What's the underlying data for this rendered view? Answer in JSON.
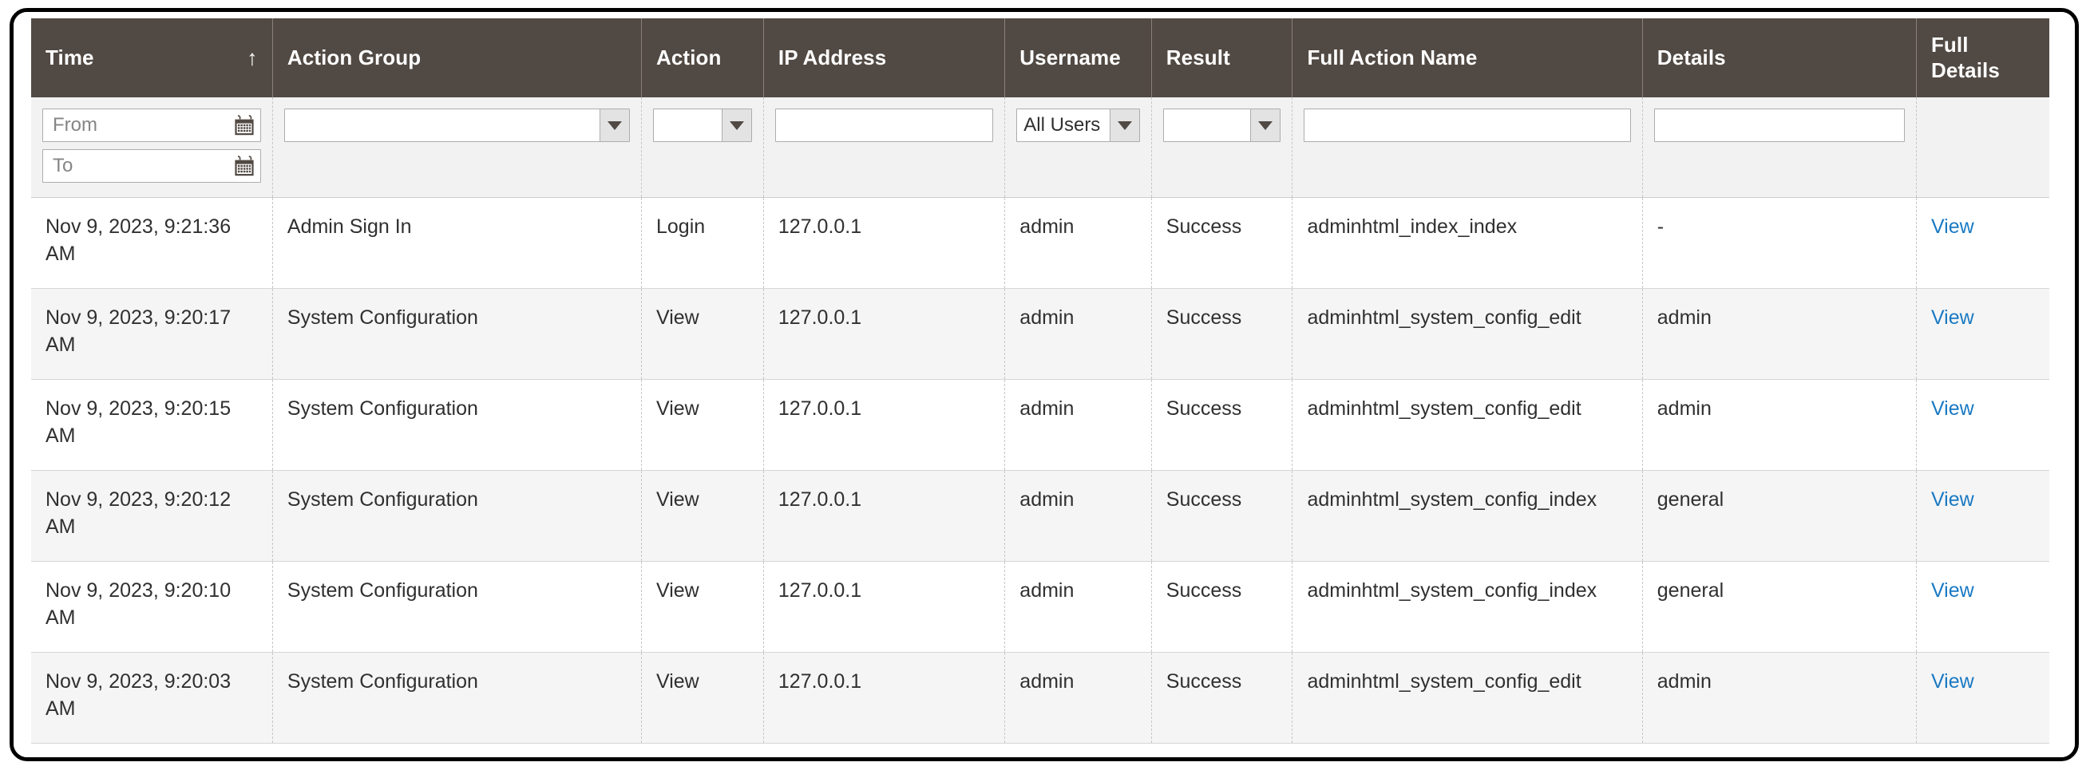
{
  "colors": {
    "header_bg": "#514943",
    "link": "#1979c3",
    "row_alt_bg": "#f5f5f5",
    "filter_bg": "#f2f2f2",
    "frame_border": "#000000"
  },
  "grid": {
    "columns": [
      {
        "key": "time",
        "label": "Time",
        "sorted": true,
        "sort_icon": "↑"
      },
      {
        "key": "action_group",
        "label": "Action Group",
        "sorted": false
      },
      {
        "key": "action",
        "label": "Action",
        "sorted": false
      },
      {
        "key": "ip_address",
        "label": "IP Address",
        "sorted": false
      },
      {
        "key": "username",
        "label": "Username",
        "sorted": false
      },
      {
        "key": "result",
        "label": "Result",
        "sorted": false
      },
      {
        "key": "full_action",
        "label": "Full Action Name",
        "sorted": false
      },
      {
        "key": "details",
        "label": "Details",
        "sorted": false
      },
      {
        "key": "full_details",
        "label": "Full Details",
        "sorted": false
      }
    ],
    "filters": {
      "time_from_placeholder": "From",
      "time_from_value": "",
      "time_to_placeholder": "To",
      "time_to_value": "",
      "action_group_value": "",
      "action_value": "",
      "ip_address_value": "",
      "ip_address_placeholder": "",
      "username_value": "All Users",
      "result_value": "",
      "full_action_value": "",
      "full_action_placeholder": "",
      "details_value": "",
      "details_placeholder": ""
    },
    "rows": [
      {
        "time": "Nov 9, 2023, 9:21:36 AM",
        "action_group": "Admin Sign In",
        "action": "Login",
        "ip_address": "127.0.0.1",
        "username": "admin",
        "result": "Success",
        "full_action": "adminhtml_index_index",
        "details": "-",
        "full_details": "View"
      },
      {
        "time": "Nov 9, 2023, 9:20:17 AM",
        "action_group": "System Configuration",
        "action": "View",
        "ip_address": "127.0.0.1",
        "username": "admin",
        "result": "Success",
        "full_action": "adminhtml_system_config_edit",
        "details": "admin",
        "full_details": "View"
      },
      {
        "time": "Nov 9, 2023, 9:20:15 AM",
        "action_group": "System Configuration",
        "action": "View",
        "ip_address": "127.0.0.1",
        "username": "admin",
        "result": "Success",
        "full_action": "adminhtml_system_config_edit",
        "details": "admin",
        "full_details": "View"
      },
      {
        "time": "Nov 9, 2023, 9:20:12 AM",
        "action_group": "System Configuration",
        "action": "View",
        "ip_address": "127.0.0.1",
        "username": "admin",
        "result": "Success",
        "full_action": "adminhtml_system_config_index",
        "details": "general",
        "full_details": "View"
      },
      {
        "time": "Nov 9, 2023, 9:20:10 AM",
        "action_group": "System Configuration",
        "action": "View",
        "ip_address": "127.0.0.1",
        "username": "admin",
        "result": "Success",
        "full_action": "adminhtml_system_config_index",
        "details": "general",
        "full_details": "View"
      },
      {
        "time": "Nov 9, 2023, 9:20:03 AM",
        "action_group": "System Configuration",
        "action": "View",
        "ip_address": "127.0.0.1",
        "username": "admin",
        "result": "Success",
        "full_action": "adminhtml_system_config_edit",
        "details": "admin",
        "full_details": "View"
      }
    ]
  }
}
